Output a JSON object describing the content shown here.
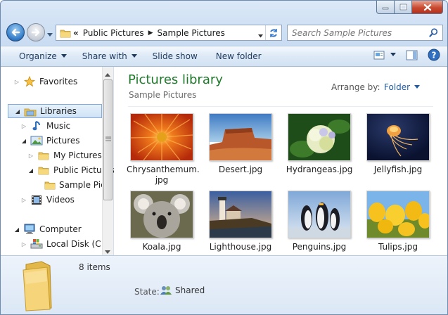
{
  "window": {
    "caption_buttons": {
      "minimize": "minimize-icon",
      "maximize": "maximize-icon",
      "close": "close-icon"
    }
  },
  "address": {
    "overflow": "«",
    "crumbs": [
      "Public Pictures",
      "Sample Pictures"
    ]
  },
  "search": {
    "placeholder": "Search Sample Pictures"
  },
  "toolbar": {
    "organize": "Organize",
    "share_with": "Share with",
    "slide_show": "Slide show",
    "new_folder": "New folder"
  },
  "nav": {
    "favorites": "Favorites",
    "libraries": "Libraries",
    "music": "Music",
    "pictures": "Pictures",
    "my_pictures": "My Pictures",
    "public_pictures": "Public Pictures",
    "sample_pictures": "Sample Pictures",
    "videos": "Videos",
    "computer": "Computer",
    "local_disk": "Local Disk (C:)"
  },
  "library": {
    "title": "Pictures library",
    "subtitle": "Sample Pictures",
    "arrange_label": "Arrange by:",
    "arrange_value": "Folder"
  },
  "files": [
    {
      "name": "Chrysanthemum.jpg",
      "line1": "Chrysanthemum.",
      "line2": "jpg"
    },
    {
      "name": "Desert.jpg"
    },
    {
      "name": "Hydrangeas.jpg"
    },
    {
      "name": "Jellyfish.jpg"
    },
    {
      "name": "Koala.jpg"
    },
    {
      "name": "Lighthouse.jpg"
    },
    {
      "name": "Penguins.jpg"
    },
    {
      "name": "Tulips.jpg"
    }
  ],
  "details": {
    "count": "8 items",
    "state_label": "State:",
    "state_value": "Shared"
  },
  "colors": {
    "library_title": "#1e7a2a",
    "accent": "#1e5ba8"
  }
}
